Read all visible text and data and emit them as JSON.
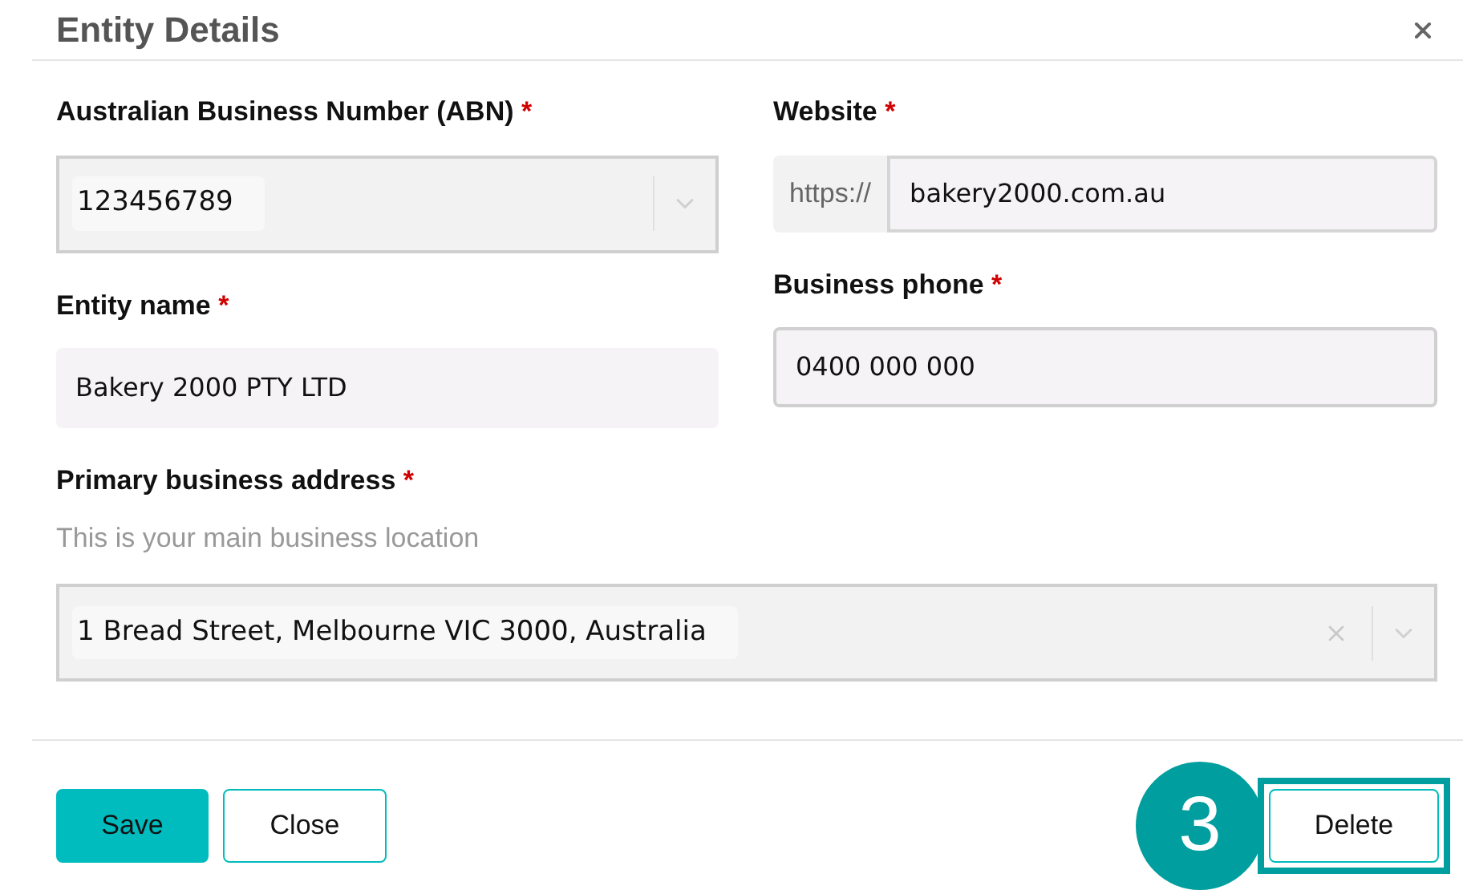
{
  "dialog": {
    "title": "Entity Details"
  },
  "left_fields": [
    {
      "kind": "select",
      "label": "Australian Business Number (ABN)",
      "required_mark": "*",
      "value": "123456789",
      "disabled": true
    },
    {
      "kind": "text",
      "label": "Entity name",
      "required_mark": "*",
      "value": "Bakery 2000 PTY LTD",
      "bordered": false
    }
  ],
  "right_fields": [
    {
      "kind": "url",
      "label": "Website",
      "required_mark": "*",
      "prefix": "https://",
      "value": "bakery2000.com.au"
    },
    {
      "kind": "text",
      "label": "Business phone",
      "required_mark": "*",
      "value": "0400 000 000",
      "bordered": true
    }
  ],
  "address": {
    "kind": "select",
    "label": "Primary business address",
    "required_mark": "*",
    "hint": "This is your main business location",
    "value": "1 Bread Street, Melbourne VIC 3000, Australia",
    "disabled": true,
    "clearable": true
  },
  "buttons": [
    {
      "label": "Save",
      "kind": "primary",
      "highlighted": false
    },
    {
      "label": "Close",
      "kind": "secondary",
      "highlighted": false
    },
    {
      "label": "Delete",
      "kind": "secondary",
      "highlighted": true
    }
  ],
  "step_badge": "3"
}
